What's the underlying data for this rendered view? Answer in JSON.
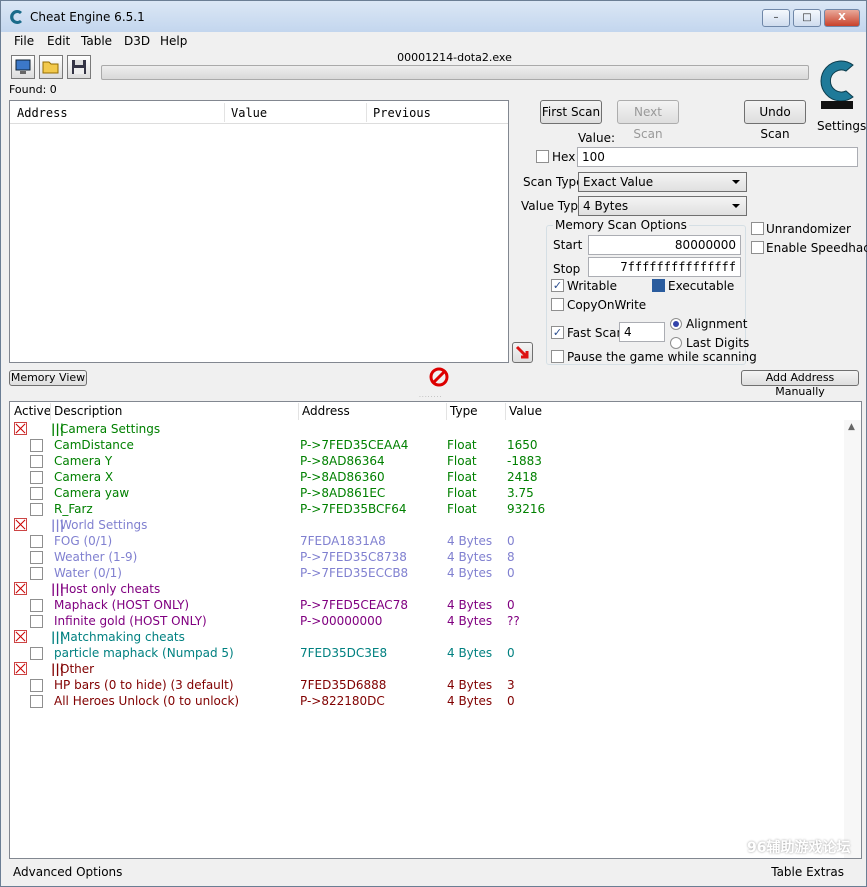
{
  "window": {
    "title": "Cheat Engine 6.5.1",
    "minimize": "–",
    "maximize": "□",
    "close": "X"
  },
  "menu": [
    "File",
    "Edit",
    "Table",
    "D3D",
    "Help"
  ],
  "process": "00001214-dota2.exe",
  "found": "Found: 0",
  "scan_list": {
    "columns": [
      "Address",
      "Value",
      "Previous"
    ]
  },
  "buttons": {
    "first_scan": "First Scan",
    "next_scan": "Next Scan",
    "undo_scan": "Undo Scan",
    "memory_view": "Memory View",
    "add_address": "Add Address Manually",
    "settings": "Settings"
  },
  "scan": {
    "value_label": "Value:",
    "hex_label": "Hex",
    "value": "100",
    "scan_type_label": "Scan Type",
    "scan_type": "Exact Value",
    "value_type_label": "Value Type",
    "value_type": "4 Bytes",
    "options_title": "Memory Scan Options",
    "start_label": "Start",
    "start": "80000000",
    "stop_label": "Stop",
    "stop": "7fffffffffffffff",
    "writable": "Writable",
    "executable": "Executable",
    "copyonwrite": "CopyOnWrite",
    "fastscan": "Fast Scan",
    "fastscan_value": "4",
    "alignment": "Alignment",
    "lastdigits": "Last Digits",
    "pause": "Pause the game while scanning",
    "unrandomizer": "Unrandomizer",
    "speedhack": "Enable Speedhack"
  },
  "table": {
    "columns": [
      "Active",
      "Description",
      "Address",
      "Type",
      "Value"
    ],
    "rows": [
      {
        "group": true,
        "desc": "Camera Settings",
        "color": "#008000"
      },
      {
        "desc": "CamDistance",
        "addr": "P->7FED35CEAA4",
        "type": "Float",
        "value": "1650",
        "color": "#008000"
      },
      {
        "desc": "Camera Y",
        "addr": "P->8AD86364",
        "type": "Float",
        "value": "-1883",
        "color": "#008000"
      },
      {
        "desc": "Camera X",
        "addr": "P->8AD86360",
        "type": "Float",
        "value": "2418",
        "color": "#008000"
      },
      {
        "desc": "Camera yaw",
        "addr": "P->8AD861EC",
        "type": "Float",
        "value": "3.75",
        "color": "#008000"
      },
      {
        "desc": "R_Farz",
        "addr": "P->7FED35BCF64",
        "type": "Float",
        "value": "93216",
        "color": "#008000"
      },
      {
        "group": true,
        "desc": "World Settings",
        "color": "#8080d0"
      },
      {
        "desc": "FOG (0/1)",
        "addr": "7FEDA1831A8",
        "type": "4 Bytes",
        "value": "0",
        "color": "#8080d0"
      },
      {
        "desc": "Weather (1-9)",
        "addr": "P->7FED35C8738",
        "type": "4 Bytes",
        "value": "8",
        "color": "#8080d0"
      },
      {
        "desc": "Water (0/1)",
        "addr": "P->7FED35ECCB8",
        "type": "4 Bytes",
        "value": "0",
        "color": "#8080d0"
      },
      {
        "group": true,
        "desc": "Host only cheats",
        "color": "#800080"
      },
      {
        "desc": "Maphack (HOST ONLY)",
        "addr": "P->7FED5CEAC78",
        "type": "4 Bytes",
        "value": "0",
        "color": "#800080"
      },
      {
        "desc": "Infinite gold (HOST ONLY)",
        "addr": "P->00000000",
        "type": "4 Bytes",
        "value": "??",
        "color": "#800080"
      },
      {
        "group": true,
        "desc": "Matchmaking cheats",
        "color": "#008080"
      },
      {
        "desc": "particle maphack (Numpad 5)",
        "addr": "7FED35DC3E8",
        "type": "4 Bytes",
        "value": "0",
        "color": "#008080"
      },
      {
        "group": true,
        "desc": "Other",
        "color": "#800000"
      },
      {
        "desc": "HP bars (0 to hide) (3 default)",
        "addr": "7FED35D6888",
        "type": "4 Bytes",
        "value": "3",
        "color": "#800000"
      },
      {
        "desc": "All Heroes Unlock (0 to unlock)",
        "addr": "P->822180DC",
        "type": "4 Bytes",
        "value": "0",
        "color": "#800000"
      }
    ]
  },
  "footer": {
    "advanced": "Advanced Options",
    "extras": "Table Extras"
  },
  "watermark": "96辅助游戏论坛"
}
